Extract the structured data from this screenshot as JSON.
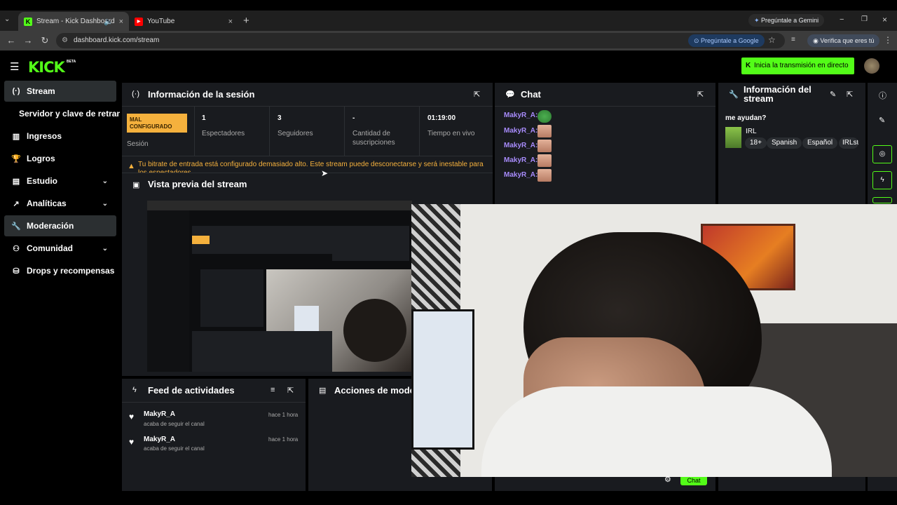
{
  "browser": {
    "tabs": [
      {
        "label": "Stream - Kick Dashboard",
        "active": true
      },
      {
        "label": "YouTube",
        "active": false
      }
    ],
    "gemini_button": "Pregúntale a Gemini",
    "url": "dashboard.kick.com/stream",
    "ask_google": "Pregúntale a Google",
    "verify": "Verifica que eres tú"
  },
  "header": {
    "logo": "KICK",
    "beta": "BETA",
    "go_live": "Inicia la transmisión en directo"
  },
  "sidebar": {
    "items": [
      {
        "label": "Stream",
        "icon": "broadcast-icon"
      },
      {
        "label": "Servidor y clave de retransmisión",
        "icon": ""
      },
      {
        "label": "Ingresos",
        "icon": "bar-chart-icon"
      },
      {
        "label": "Logros",
        "icon": "trophy-icon"
      },
      {
        "label": "Estudio",
        "icon": "layout-icon"
      },
      {
        "label": "Analíticas",
        "icon": "analytics-icon"
      },
      {
        "label": "Moderación",
        "icon": "wrench-icon"
      },
      {
        "label": "Comunidad",
        "icon": "community-icon"
      },
      {
        "label": "Drops y recompensas",
        "icon": "drops-icon"
      }
    ]
  },
  "session": {
    "title": "Información de la sesión",
    "badge": "MAL CONFIGURADO",
    "badge_label": "Sesión",
    "viewers_value": "1",
    "viewers_label": "Espectadores",
    "followers_value": "3",
    "followers_label": "Seguidores",
    "subs_value": "-",
    "subs_label": "Cantidad de suscripciones",
    "time_value": "01:19:00",
    "time_label": "Tiempo en vivo",
    "warning": "Tu bitrate de entrada está configurado demasiado alto. Este stream puede desconectarse y será inestable para los espectadores"
  },
  "preview": {
    "title": "Vista previa del stream"
  },
  "chat": {
    "title": "Chat",
    "messages": [
      {
        "user": "MakyR_A:"
      },
      {
        "user": "MakyR_A:"
      },
      {
        "user": "MakyR_A:"
      },
      {
        "user": "MakyR_A:"
      },
      {
        "user": "MakyR_A:"
      }
    ],
    "send_button": "Chat"
  },
  "stream_info": {
    "title": "Información del stream",
    "stream_title": "me ayudan?",
    "category": "IRL",
    "tags": [
      "18+",
      "Spanish",
      "Español",
      "IRLst"
    ]
  },
  "feed": {
    "title": "Feed de actividades",
    "items": [
      {
        "user": "MakyR_A",
        "action": "acaba de seguir el canal",
        "time": "hace 1 hora"
      },
      {
        "user": "MakyR_A",
        "action": "acaba de seguir el canal",
        "time": "hace 1 hora"
      }
    ]
  },
  "mod_actions": {
    "title": "Acciones de moderación"
  },
  "colors": {
    "accent": "#53fc18",
    "panel": "#191b1f",
    "warning": "#f5b13d",
    "chat_user": "#a78bfa"
  }
}
